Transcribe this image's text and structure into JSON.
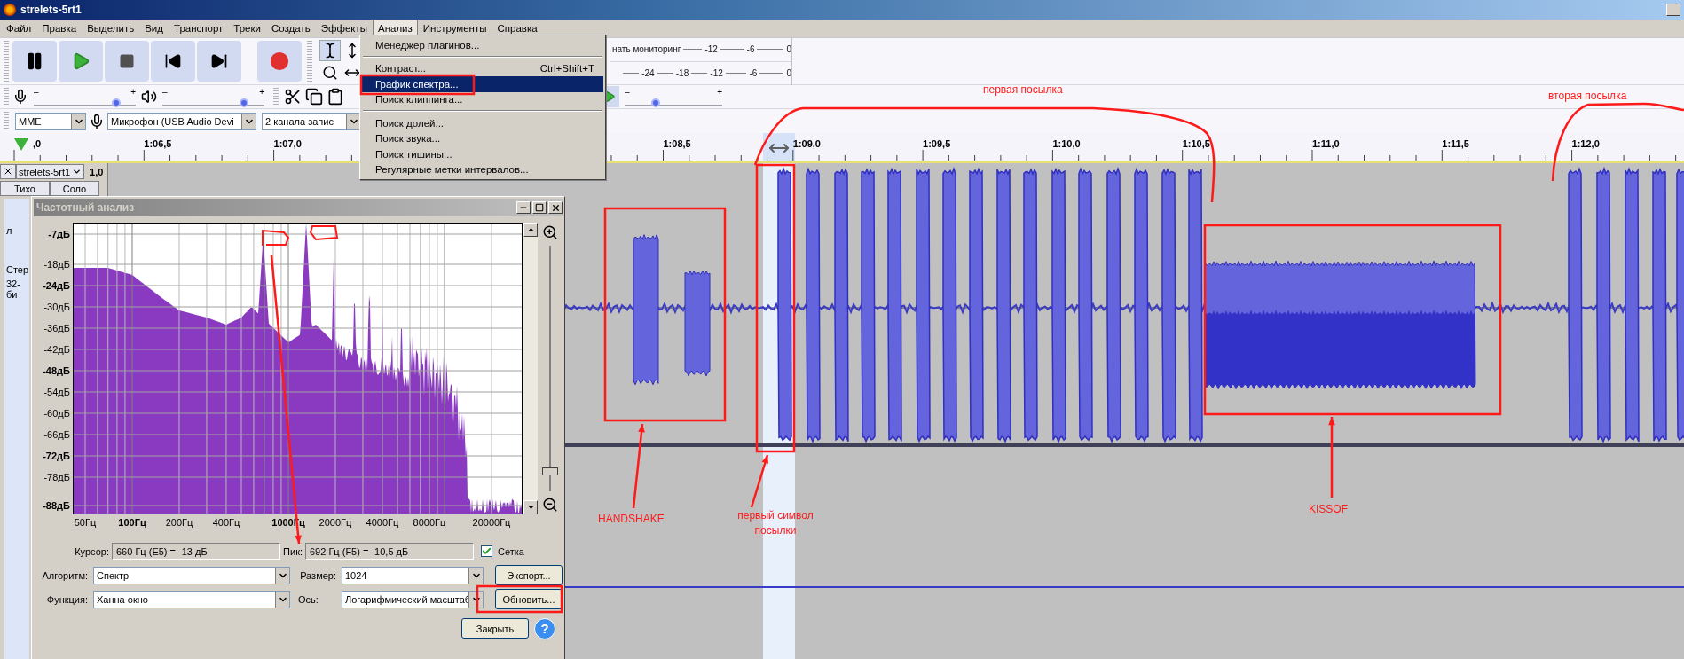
{
  "window": {
    "title": "strelets-5rt1"
  },
  "menu_bar": [
    {
      "label": "Файл",
      "selected": false
    },
    {
      "label": "Правка",
      "selected": false
    },
    {
      "label": "Выделить",
      "selected": false
    },
    {
      "label": "Вид",
      "selected": false
    },
    {
      "label": "Транспорт",
      "selected": false
    },
    {
      "label": "Треки",
      "selected": false
    },
    {
      "label": "Создать",
      "selected": false
    },
    {
      "label": "Эффекты",
      "selected": false
    },
    {
      "label": "Анализ",
      "selected": true
    },
    {
      "label": "Инструменты",
      "selected": false
    },
    {
      "label": "Справка",
      "selected": false
    }
  ],
  "analysis_menu": [
    {
      "kind": "item",
      "label": "Менеджер плагинов...",
      "selected": false
    },
    {
      "kind": "separator"
    },
    {
      "kind": "item",
      "label": "Контраст...",
      "shortcut": "Ctrl+Shift+T",
      "selected": false
    },
    {
      "kind": "item",
      "label": "График спектра...",
      "selected": true
    },
    {
      "kind": "item",
      "label": "Поиск клиппинга...",
      "selected": false
    },
    {
      "kind": "separator"
    },
    {
      "kind": "item",
      "label": "Поиск долей...",
      "selected": false
    },
    {
      "kind": "item",
      "label": "Поиск звука...",
      "selected": false
    },
    {
      "kind": "item",
      "label": "Поиск тишины...",
      "selected": false
    },
    {
      "kind": "item",
      "label": "Регулярные метки интервалов...",
      "selected": false
    }
  ],
  "record_meter": {
    "label": "нать мониторинг",
    "ticks": [
      "-12",
      "-6",
      "0"
    ]
  },
  "playback_meter": {
    "ticks": [
      "-24",
      "-18",
      "-12",
      "-6",
      "0"
    ]
  },
  "mixer": {
    "record": {
      "level": 0.81,
      "min": "–",
      "max": "+"
    },
    "playback": {
      "level": 0.8,
      "min": "–",
      "max": "+"
    }
  },
  "play_at_speed": {
    "level": 0.32,
    "min": "–",
    "max": "+"
  },
  "device_toolbar": {
    "host": "MME",
    "input": "Микрофон (USB Audio Devi",
    "channels": "2  канала запис"
  },
  "timeline": {
    "labels": [
      ",0",
      "1:06,5",
      "1:07,0",
      "1:08,5",
      "1:09,0",
      "1:09,5",
      "1:10,0",
      "1:10,5",
      "1:11,0",
      "1:11,5",
      "1:12,0"
    ]
  },
  "track": {
    "name": "strelets-5rt1",
    "gain": "1,0",
    "buttons": [
      "Тихо",
      "Соло"
    ],
    "pan_label": "л",
    "info": [
      "Стер",
      "32-би"
    ]
  },
  "spectrum_dialog": {
    "title": "Частотный анализ",
    "y_ticks": [
      "-7дБ",
      "-18дБ",
      "-24дБ",
      "-30дБ",
      "-36дБ",
      "-42дБ",
      "-48дБ",
      "-54дБ",
      "-60дБ",
      "-66дБ",
      "-72дБ",
      "-78дБ",
      "-88дБ"
    ],
    "x_ticks": [
      "50Гц",
      "100Гц",
      "200Гц",
      "400Гц",
      "1000Гц",
      "2000Гц",
      "4000Гц",
      "8000Гц",
      "20000Гц"
    ],
    "cursor": {
      "label": "Курсор:",
      "value": "660 Гц (E5) = -13 дБ"
    },
    "peak": {
      "label": "Пик:",
      "value": "692 Гц (F5) = -10,5 дБ"
    },
    "grid": {
      "label": "Сетка",
      "checked": true
    },
    "algorithm": {
      "label": "Алгоритм:",
      "value": "Спектр"
    },
    "size": {
      "label": "Размер:",
      "value": "1024"
    },
    "function": {
      "label": "Функция:",
      "value": "Ханна  окно"
    },
    "axis": {
      "label": "Ось:",
      "value": "Логарифмический масштаб"
    },
    "zoom": {
      "level": 0.08
    },
    "export_button": "Экспорт...",
    "update_button": "Обновить...",
    "close_button": "Закрыть",
    "help_button": "?"
  },
  "annotations": [
    {
      "text": "первая посылка"
    },
    {
      "text": "вторая посылка"
    },
    {
      "text": "HANDSHAKE"
    },
    {
      "text": "первый символ посылки"
    },
    {
      "text": "KISSOF"
    }
  ]
}
